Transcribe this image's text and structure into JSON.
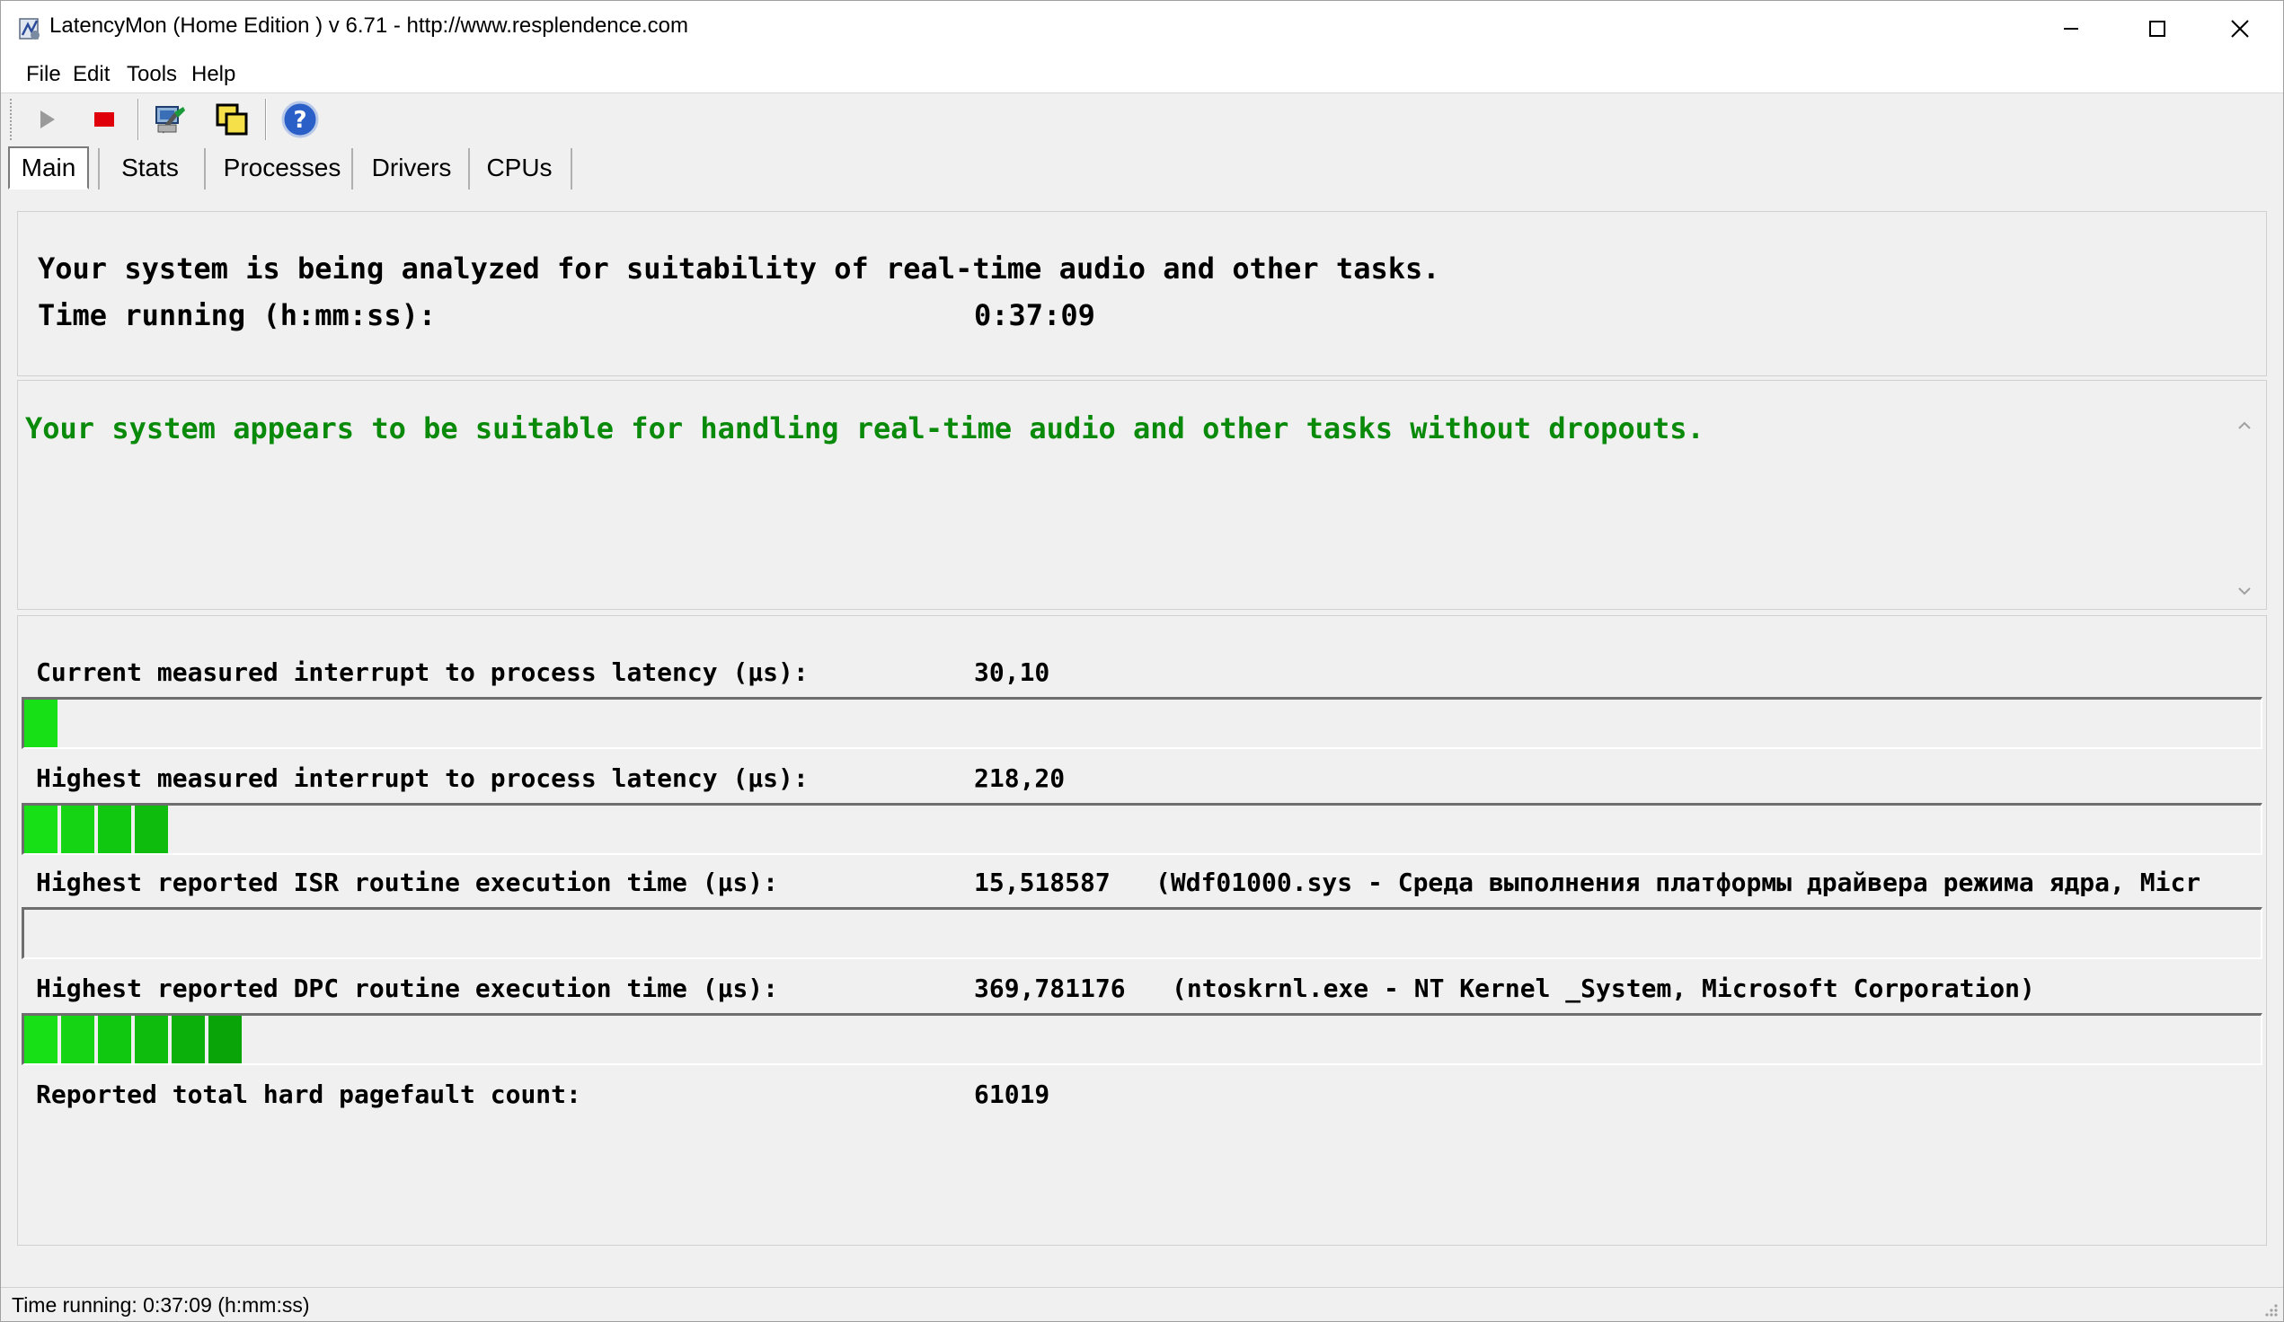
{
  "window": {
    "title": "LatencyMon  (Home Edition )  v 6.71 - http://www.resplendence.com"
  },
  "menu": [
    "File",
    "Edit",
    "Tools",
    "Help"
  ],
  "toolbar": {
    "buttons": [
      "play-icon",
      "stop-icon",
      "system-info-icon",
      "window-icon",
      "help-icon"
    ]
  },
  "tabs": [
    "Main",
    "Stats",
    "Processes",
    "Drivers",
    "CPUs"
  ],
  "analysis": {
    "line1": "Your system is being analyzed for suitability of real-time audio and other tasks.",
    "time_label": "Time running (h:mm:ss):",
    "time_value": "0:37:09"
  },
  "verdict": {
    "text": "Your system appears to be suitable for handling real-time audio and other tasks without dropouts.",
    "color": "#0a8a0a"
  },
  "metrics": [
    {
      "label": "Current measured interrupt to process latency (µs):",
      "value": "30,10",
      "detail": "",
      "bar_segments": 1
    },
    {
      "label": "Highest measured interrupt to process latency (µs):",
      "value": "218,20",
      "detail": "",
      "bar_segments": 4
    },
    {
      "label": "Highest reported ISR routine execution time (µs):",
      "value": "15,518587",
      "detail": "(Wdf01000.sys - Среда выполнения платформы драйвера режима ядра, Micr",
      "bar_segments": 0
    },
    {
      "label": "Highest reported DPC routine execution time (µs):",
      "value": "369,781176",
      "detail": "(ntoskrnl.exe - NT Kernel _System, Microsoft Corporation)",
      "bar_segments": 6
    },
    {
      "label": "Reported total hard pagefault count:",
      "value": "61019",
      "detail": ""
    }
  ],
  "status": {
    "text": "Time running: 0:37:09  (h:mm:ss)"
  }
}
